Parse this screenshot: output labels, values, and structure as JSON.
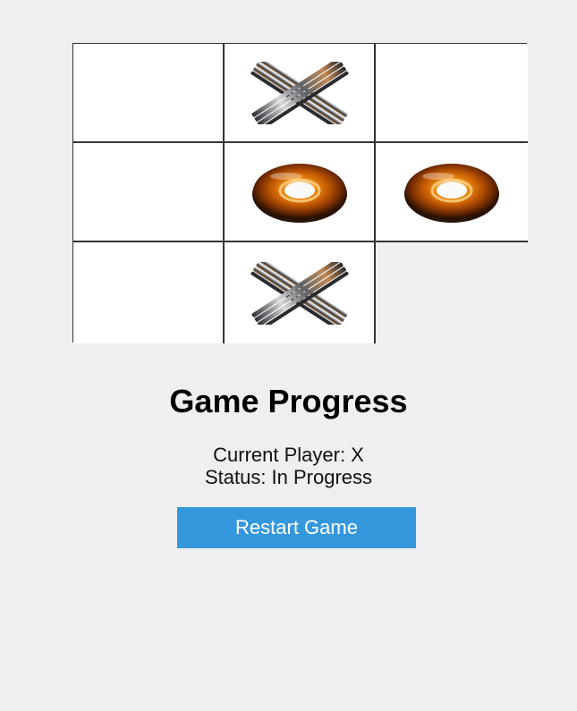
{
  "board": {
    "cells": [
      [
        "",
        "X",
        ""
      ],
      [
        "",
        "O",
        "O"
      ],
      [
        "",
        "X",
        ""
      ]
    ],
    "highlighted_cell": [
      2,
      2
    ],
    "x_icon": "metallic-x-icon",
    "o_icon": "amber-ring-o-icon"
  },
  "progress": {
    "title": "Game Progress",
    "current_player": "Current Player: X",
    "status": "Status: In Progress",
    "restart_label": "Restart Game"
  },
  "colors": {
    "background": "#efeef0",
    "cell": "#ffffff",
    "button": "#3598dc",
    "button_text": "#ffffff",
    "grid_line": "#333333"
  }
}
